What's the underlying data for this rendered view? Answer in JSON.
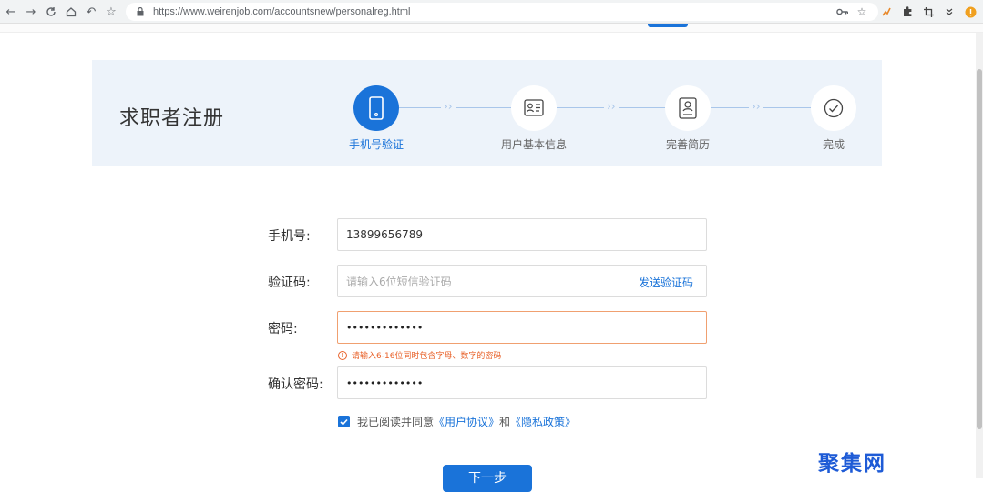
{
  "browser": {
    "url": "https://www.weirenjob.com/accountsnew/personalreg.html"
  },
  "page": {
    "title": "求职者注册",
    "steps": [
      {
        "label": "手机号验证",
        "icon": "phone-icon",
        "active": true
      },
      {
        "label": "用户基本信息",
        "icon": "id-card-icon",
        "active": false
      },
      {
        "label": "完善简历",
        "icon": "resume-icon",
        "active": false
      },
      {
        "label": "完成",
        "icon": "check-circle-icon",
        "active": false
      }
    ]
  },
  "form": {
    "phone_label": "手机号:",
    "phone_value": "13899656789",
    "code_label": "验证码:",
    "code_placeholder": "请输入6位短信验证码",
    "send_code": "发送验证码",
    "password_label": "密码:",
    "password_value": "•••••••••••••",
    "password_error": "请输入6-16位同时包含字母、数字的密码",
    "confirm_label": "确认密码:",
    "confirm_value": "•••••••••••••",
    "agree_prefix": "我已阅读并同意",
    "agree_terms": "《用户协议》",
    "agree_and": "和",
    "agree_privacy": "《隐私政策》",
    "agree_checked": true,
    "next_button": "下一步"
  },
  "watermark": "聚集网",
  "colors": {
    "accent": "#1a73d9",
    "banner_bg": "#edf3fa",
    "error": "#e8622a"
  }
}
